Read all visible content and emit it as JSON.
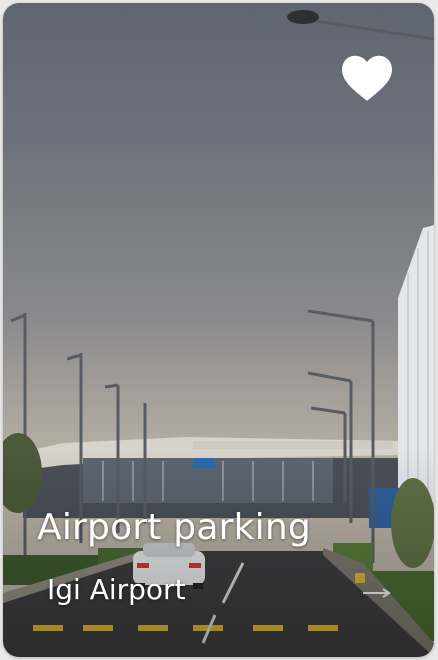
{
  "card": {
    "title": "Airport parking",
    "subtitle": "Igi Airport",
    "favorite_icon": "heart-icon",
    "favorited": true
  }
}
